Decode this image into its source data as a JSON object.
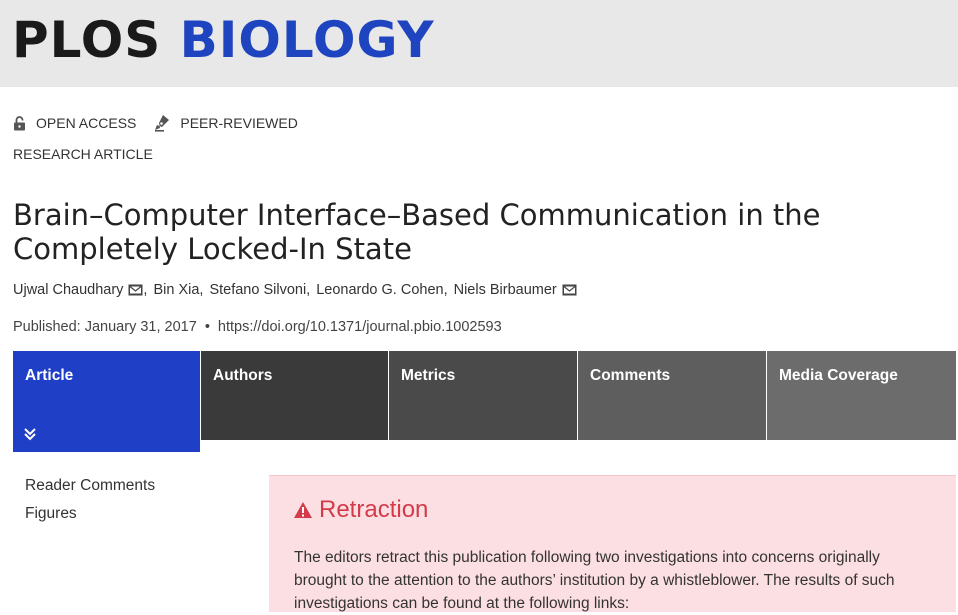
{
  "header": {
    "logo_plos": "PLOS",
    "logo_biology": "BIOLOGY",
    "bg_color": "#e8e8e8",
    "brand_color": "#1f44c0"
  },
  "badges": [
    {
      "label": "OPEN ACCESS",
      "icon": "open-lock-icon"
    },
    {
      "label": "PEER-REVIEWED",
      "icon": "pen-nib-icon"
    }
  ],
  "article_type": "RESEARCH ARTICLE",
  "title": "Brain–Computer Interface–Based Communication in the Completely Locked-In State",
  "authors": [
    {
      "name": "Ujwal Chaudhary",
      "email_icon": true
    },
    {
      "name": "Bin Xia",
      "email_icon": false
    },
    {
      "name": "Stefano Silvoni",
      "email_icon": false
    },
    {
      "name": "Leonardo G. Cohen",
      "email_icon": false
    },
    {
      "name": "Niels Birbaumer",
      "email_icon": true
    }
  ],
  "author_separator": ",",
  "published": {
    "label": "Published: January 31, 2017",
    "separator": "•",
    "doi": "https://doi.org/10.1371/journal.pbio.1002593"
  },
  "tabs": [
    {
      "label": "Article",
      "color": "#1f3fc7"
    },
    {
      "label": "Authors",
      "color": "#3a3a3a"
    },
    {
      "label": "Metrics",
      "color": "#4a4a4a"
    },
    {
      "label": "Comments",
      "color": "#5e5e5e"
    },
    {
      "label": "Media Coverage",
      "color": "#6c6c6c"
    }
  ],
  "sidenav": [
    {
      "label": "Reader Comments"
    },
    {
      "label": "Figures"
    }
  ],
  "retraction": {
    "heading": "Retraction",
    "text": "The editors retract this publication following two investigations into concerns originally brought to the attention to the authors’ institution by a whistleblower. The results of such investigations can be found at the following links:",
    "bg_color": "#fcdfe2",
    "heading_color": "#d33b4b"
  }
}
